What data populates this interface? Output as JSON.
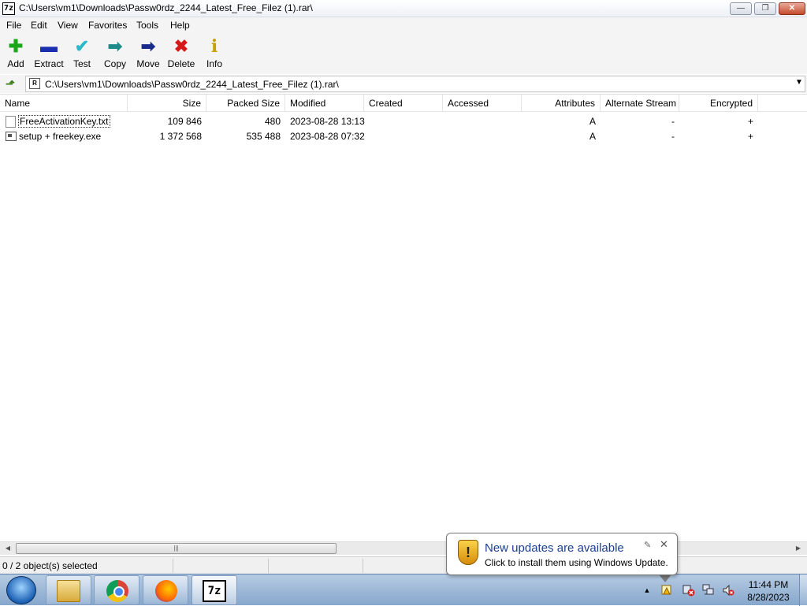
{
  "window": {
    "title": "C:\\Users\\vm1\\Downloads\\Passw0rdz_2244_Latest_Free_Filez (1).rar\\",
    "app_icon_text": "7z",
    "buttons": {
      "minimize": "—",
      "maximize": "❐",
      "close": "✕"
    }
  },
  "menu": [
    "File",
    "Edit",
    "View",
    "Favorites",
    "Tools",
    "Help"
  ],
  "toolbar": {
    "items": [
      {
        "label": "Add",
        "icon": "plus-icon",
        "glyph": "✚",
        "color": "#1aa81a"
      },
      {
        "label": "Extract",
        "icon": "minus-icon",
        "glyph": "▬",
        "color": "#1a2fb0"
      },
      {
        "label": "Test",
        "icon": "check-icon",
        "glyph": "✔",
        "color": "#2bb8c8"
      },
      {
        "label": "Copy",
        "icon": "double-arrow-icon",
        "glyph": "➡",
        "color": "#1f8a8a"
      },
      {
        "label": "Move",
        "icon": "arrow-right-icon",
        "glyph": "➡",
        "color": "#1a2a8a"
      },
      {
        "label": "Delete",
        "icon": "x-icon",
        "glyph": "✖",
        "color": "#d61a1a"
      },
      {
        "label": "Info",
        "icon": "info-icon",
        "glyph": "i",
        "color": "#c8a000"
      }
    ]
  },
  "address": {
    "path": "C:\\Users\\vm1\\Downloads\\Passw0rdz_2244_Latest_Free_Filez (1).rar\\",
    "icon_text": "R",
    "up_icon": "⬏",
    "dropdown_icon": "▼"
  },
  "columns": [
    "Name",
    "Size",
    "Packed Size",
    "Modified",
    "Created",
    "Accessed",
    "Attributes",
    "Alternate Stream",
    "Encrypted"
  ],
  "files": [
    {
      "name": "FreeActivationKey.txt",
      "size": "109 846",
      "packed": "480",
      "modified": "2023-08-28 13:13",
      "created": "",
      "accessed": "",
      "attributes": "A",
      "alt_stream": "-",
      "encrypted": "+"
    },
    {
      "name": "setup + freekey.exe",
      "size": "1 372 568",
      "packed": "535 488",
      "modified": "2023-08-28 07:32",
      "created": "",
      "accessed": "",
      "attributes": "A",
      "alt_stream": "-",
      "encrypted": "+"
    }
  ],
  "scrollbar": {
    "left_arrow": "◀",
    "right_arrow": "▶",
    "grip": "|||"
  },
  "status": {
    "selection": "0 / 2 object(s) selected"
  },
  "notification": {
    "title": "New updates are available",
    "body": "Click to install them using Windows Update.",
    "shield_glyph": "!",
    "pin_glyph": "✎",
    "close_glyph": "✕"
  },
  "taskbar": {
    "sevenzip_text": "7z",
    "tray": {
      "arrow": "▲",
      "time": "11:44 PM",
      "date": "8/28/2023"
    }
  }
}
